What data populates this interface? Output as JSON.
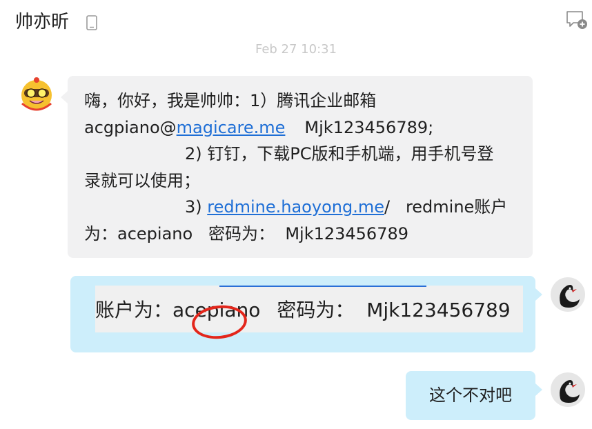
{
  "header": {
    "contact_name": "帅亦昕",
    "device_icon": "phone-icon",
    "new_chat_icon": "new-chat-icon"
  },
  "conversation": {
    "timestamp": "Feb 27  10:31",
    "incoming": {
      "avatar_icon": "cartoon-avatar-icon",
      "line1": "嗨，你好，我是帅帅：1）腾讯企业邮箱",
      "line2_prefix": "acgpiano@",
      "line2_link": "magicare.me",
      "line2_suffix": "Mjk123456789;",
      "line3": "2) 钉钉，下载PC版和手机端，用手机号登",
      "line4": "录就可以使用；",
      "line5_prefix": "3) ",
      "line5_link": "redmine.haoyong.me",
      "line5_suffix": "/   redmine账户",
      "line6": "为：acepiano   密码为：  Mjk123456789"
    },
    "image_reply": {
      "avatar_icon": "swan-avatar-icon",
      "text_prefix": "账户为：",
      "text_highlight": "acepiano",
      "text_suffix": "密码为：  Mjk123456789",
      "annotation_icon": "red-circle-annotation"
    },
    "outgoing": {
      "avatar_icon": "swan-avatar-icon",
      "text": "这个不对吧"
    }
  },
  "colors": {
    "incoming_bubble": "#f1f1f2",
    "outgoing_bubble": "#cdeefb",
    "link": "#1f6fd6",
    "annotation": "#e3261b"
  }
}
